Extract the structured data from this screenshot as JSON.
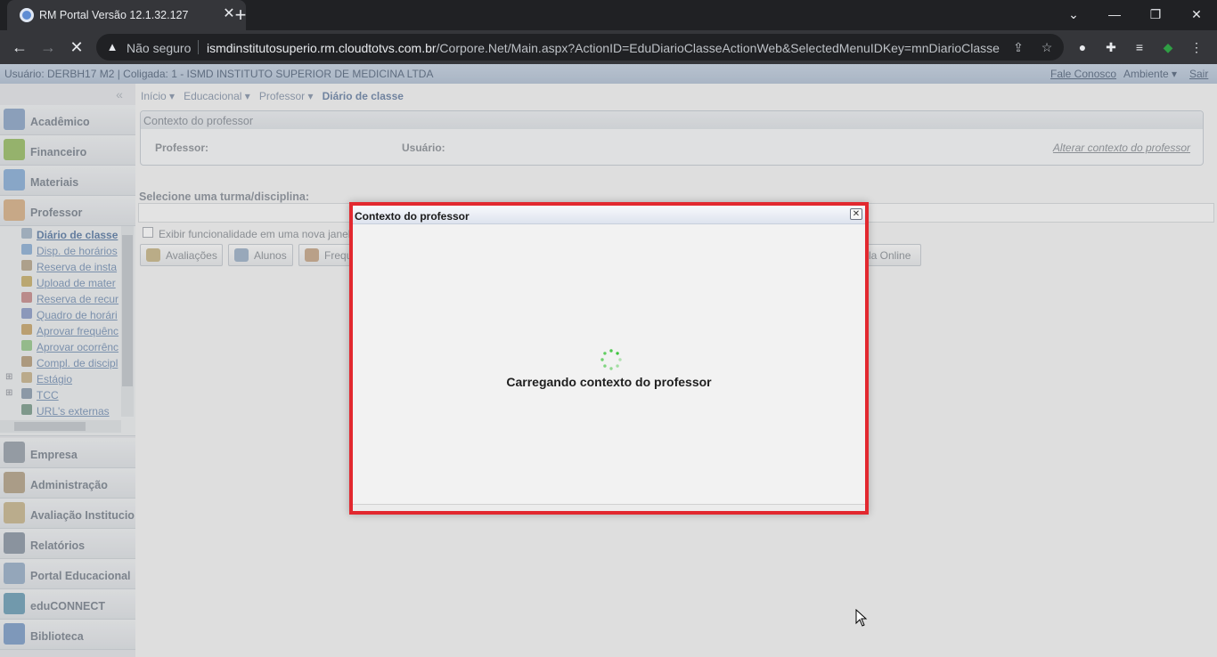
{
  "browser": {
    "tab_title": "RM Portal Versão 12.1.32.127",
    "tab_close": "✕",
    "new_tab": "+",
    "insecure_label": "Não seguro",
    "url_host": "ismdinstitutosuperio.rm.cloudtotvs.com.br",
    "url_path": "/Corpore.Net/Main.aspx?ActionID=EduDiarioClasseActionWeb&SelectedMenuIDKey=mnDiarioClasse",
    "window_minimize": "⌄",
    "window_min": "—",
    "window_restore": "❐",
    "window_close": "✕"
  },
  "userbar": {
    "info": "Usuário: DERBH17 M2  |  Coligada: 1 - ISMD INSTITUTO SUPERIOR DE MEDICINA LTDA",
    "contact": "Fale Conosco",
    "environment": "Ambiente ▾",
    "logout": "Sair"
  },
  "sidebar": {
    "collapse": "«",
    "modules": [
      {
        "label": "Acadêmico",
        "color": "#8fa8c8"
      },
      {
        "label": "Financeiro",
        "color": "#9bbf6a"
      },
      {
        "label": "Materiais",
        "color": "#8bb0d8"
      },
      {
        "label": "Professor",
        "color": "#d8b28a"
      },
      {
        "label": "Empresa",
        "color": "#9aa3ad"
      },
      {
        "label": "Administração",
        "color": "#b5a48a"
      },
      {
        "label": "Avaliação Institucio",
        "color": "#c8b890"
      },
      {
        "label": "Relatórios",
        "color": "#8e99a6"
      },
      {
        "label": "Portal Educacional",
        "color": "#9ab0c8"
      },
      {
        "label": "eduCONNECT",
        "color": "#6fa0b8"
      },
      {
        "label": "Biblioteca",
        "color": "#7f9fc8"
      }
    ],
    "professor_items": [
      {
        "label": "Diário de classe",
        "current": true
      },
      {
        "label": "Disp. de horários"
      },
      {
        "label": "Reserva de insta"
      },
      {
        "label": "Upload de mater"
      },
      {
        "label": "Reserva de recur"
      },
      {
        "label": "Quadro de horári"
      },
      {
        "label": "Aprovar frequênc"
      },
      {
        "label": "Aprovar ocorrênc"
      },
      {
        "label": "Compl. de discipl"
      },
      {
        "label": "Estágio",
        "expandable": true
      },
      {
        "label": "TCC",
        "expandable": true
      },
      {
        "label": "URL's externas"
      }
    ]
  },
  "breadcrumb": {
    "items": [
      "Início ▾",
      "Educacional ▾",
      "Professor ▾"
    ],
    "current": "Diário de classe"
  },
  "context_box": {
    "title": "Contexto do professor",
    "professor_label": "Professor:",
    "user_label": "Usuário:",
    "change_link": "Alterar contexto do professor"
  },
  "selection": {
    "label": "Selecione uma turma/disciplina:",
    "checkbox_label": "Exibir funcionalidade em uma nova janela"
  },
  "toolbar": {
    "evaluations": "Avaliações",
    "students": "Alunos",
    "attendance": "Frequ",
    "online_class": "la Online"
  },
  "modal": {
    "title": "Contexto do professor",
    "close": "✕",
    "loading_text": "Carregando contexto do professor",
    "spinner_color": "#3cc43c"
  }
}
